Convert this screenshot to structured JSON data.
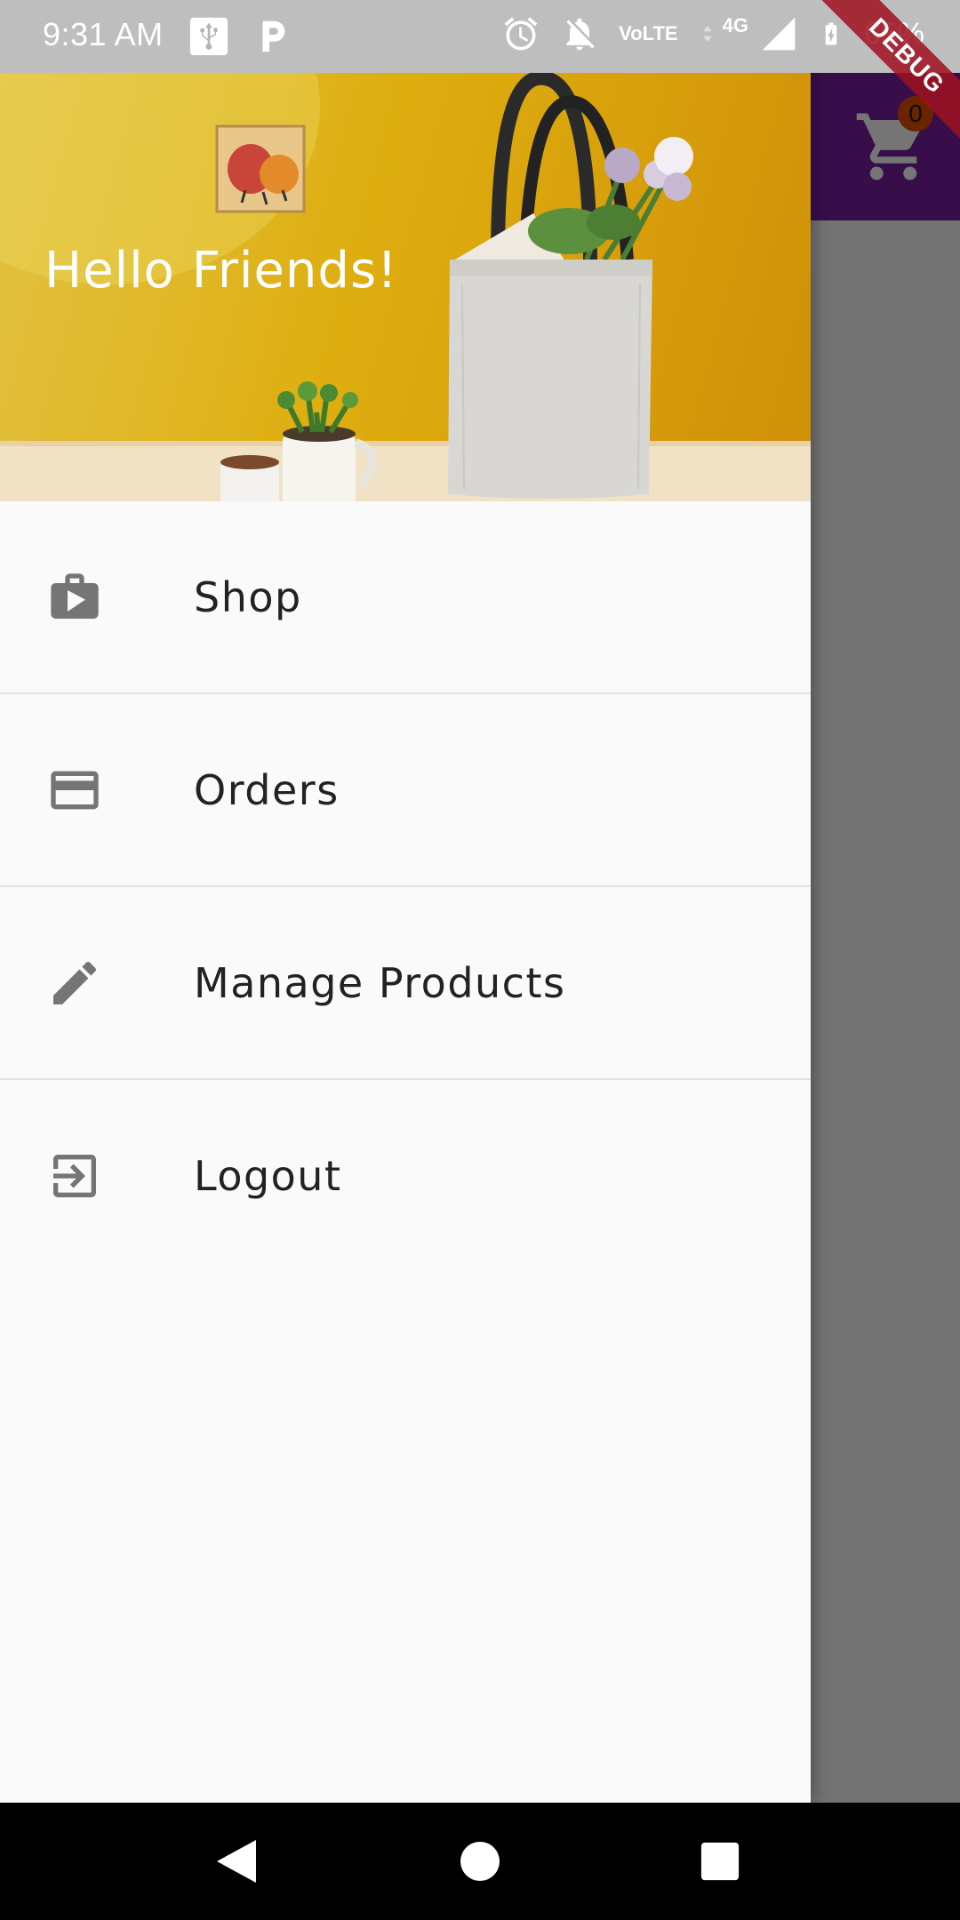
{
  "status_bar": {
    "time": "9:31 AM",
    "left_icons": [
      "usb-icon",
      "parking-icon"
    ],
    "right_icons": [
      "alarm-icon",
      "notifications-off-icon",
      "volte-icon",
      "data-arrows-icon",
      "signal-icon",
      "battery-charging-icon"
    ],
    "network_type": "4G",
    "volte_label": "VoLTE",
    "battery_percent": "65%"
  },
  "debug_banner": {
    "label": "DEBUG",
    "color": "#a01020"
  },
  "app_bar": {
    "color": "#7b1fa2",
    "cart_icon": "shopping-cart-icon",
    "cart_badge": "0"
  },
  "drawer": {
    "header": {
      "title": "Hello Friends!",
      "background_image": "tote-bag-flowers-yellow-wall"
    },
    "items": [
      {
        "label": "Shop",
        "icon": "shop-bag-icon"
      },
      {
        "label": "Orders",
        "icon": "credit-card-icon"
      },
      {
        "label": "Manage Products",
        "icon": "edit-pencil-icon"
      },
      {
        "label": "Logout",
        "icon": "exit-to-app-icon"
      }
    ],
    "icon_color": "#757575"
  },
  "nav_bar": {
    "buttons": [
      "back-icon",
      "home-icon",
      "recents-icon"
    ]
  }
}
